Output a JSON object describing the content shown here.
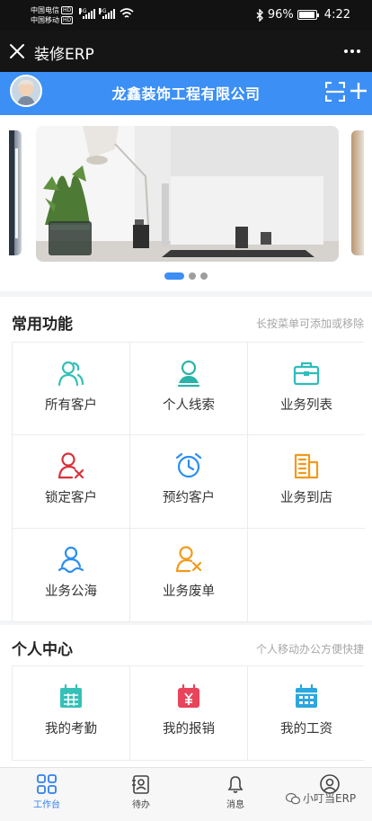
{
  "status_bar": {
    "carrier1": "中国电信",
    "carrier2": "中国移动",
    "hd": "HD",
    "network": "4G",
    "battery": "96%",
    "battery_level": 0.96,
    "time": "4:22"
  },
  "app_bar": {
    "title": "装修ERP"
  },
  "company": {
    "name": "龙鑫装饰工程有限公司"
  },
  "banner": {
    "slide_count": 3,
    "active_index": 0
  },
  "common_functions": {
    "title": "常用功能",
    "hint": "长按菜单可添加或移除",
    "items": [
      {
        "label": "所有客户",
        "icon": "users-icon",
        "color": "#35c0b8"
      },
      {
        "label": "个人线索",
        "icon": "person-icon",
        "color": "#2bb3a8"
      },
      {
        "label": "业务列表",
        "icon": "briefcase-icon",
        "color": "#2fbcb9"
      },
      {
        "label": "锁定客户",
        "icon": "user-remove-icon",
        "color": "#d9313a"
      },
      {
        "label": "预约客户",
        "icon": "alarm-clock-icon",
        "color": "#2a8ef0"
      },
      {
        "label": "业务到店",
        "icon": "building-icon",
        "color": "#f29a1b"
      },
      {
        "label": "业务公海",
        "icon": "person-wave-icon",
        "color": "#2a8ef0"
      },
      {
        "label": "业务废单",
        "icon": "user-cancel-icon",
        "color": "#f29a1b"
      }
    ]
  },
  "personal_center": {
    "title": "个人中心",
    "hint": "个人移动办公方便快捷",
    "items": [
      {
        "label": "我的考勤",
        "icon": "calendar-icon",
        "color": "#35c0b8"
      },
      {
        "label": "我的报销",
        "icon": "yen-calendar-icon",
        "color": "#e8445a"
      },
      {
        "label": "我的工资",
        "icon": "calendar-grid-icon",
        "color": "#2ba6df"
      }
    ]
  },
  "tabs": [
    {
      "label": "工作台",
      "icon": "grid-icon",
      "active": true
    },
    {
      "label": "待办",
      "icon": "todo-icon",
      "active": false
    },
    {
      "label": "消息",
      "icon": "bell-icon",
      "active": false
    },
    {
      "label": "",
      "icon": "profile-icon",
      "active": false
    }
  ],
  "watermark": "小叮当ERP"
}
